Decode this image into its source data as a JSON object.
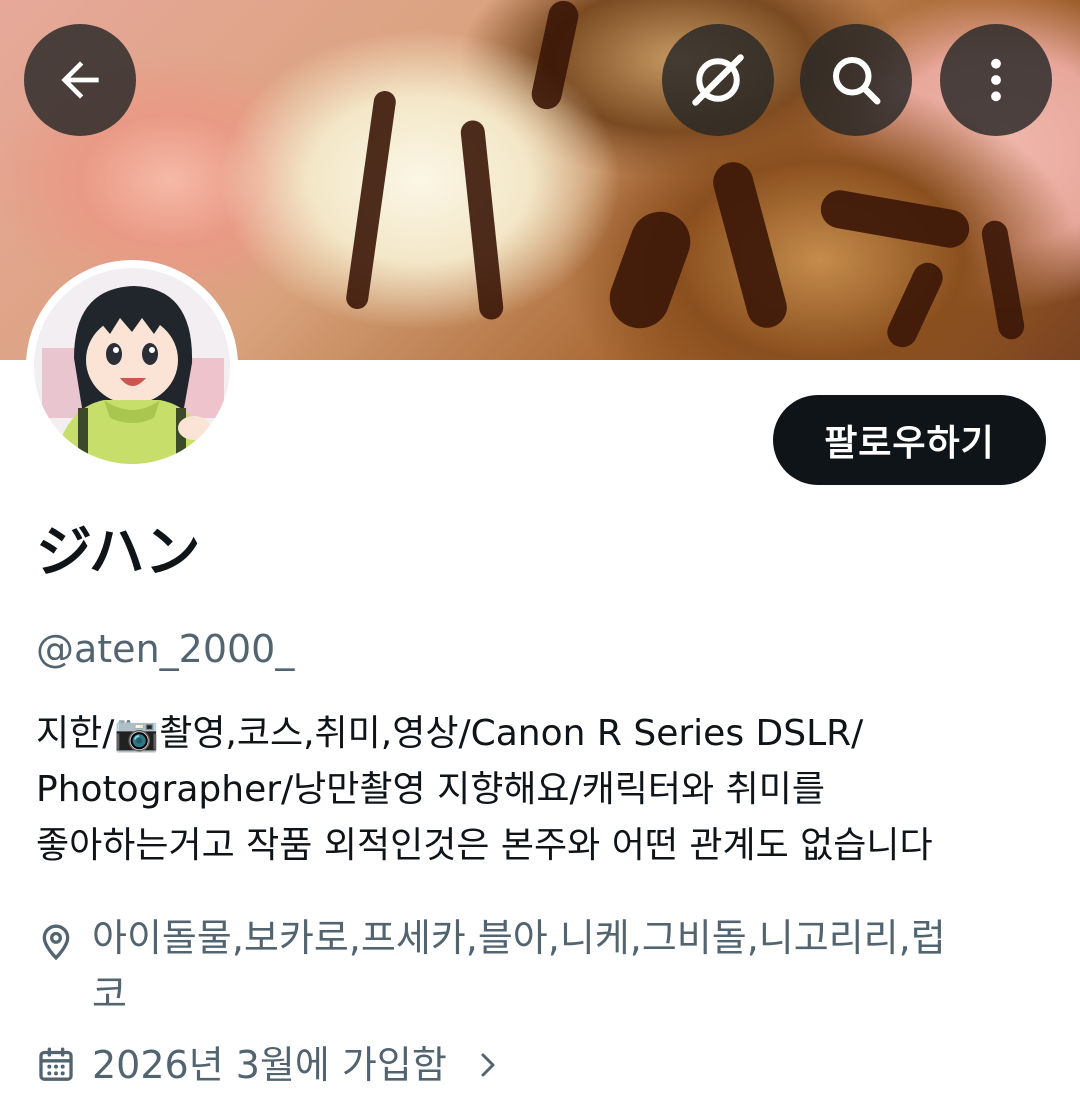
{
  "header": {
    "back_icon": "arrow-left-icon",
    "grok_icon": "grok-icon",
    "search_icon": "search-icon",
    "more_icon": "more-vertical-icon"
  },
  "profile": {
    "display_name": "ジハン",
    "handle": "@aten_2000_",
    "follow_label": "팔로우하기",
    "bio_lines": [
      "지한/📷촬영,코스,취미,영상/Canon R Series DSLR/",
      "Photographer/낭만촬영 지향해요/캐릭터와 취미를",
      "좋아하는거고 작품 외적인것은 본주와 어떤 관계도 없습니다"
    ],
    "location_line1": "아이돌물,보카로,프세카,블아,니케,그비돌,니고리리,럽",
    "location_line2": "코",
    "joined": "2026년 3월에 가입함"
  },
  "colors": {
    "text_primary": "#0f1419",
    "text_secondary": "#536471",
    "button_bg": "#0f1419",
    "overlay_button_bg": "#272727"
  }
}
